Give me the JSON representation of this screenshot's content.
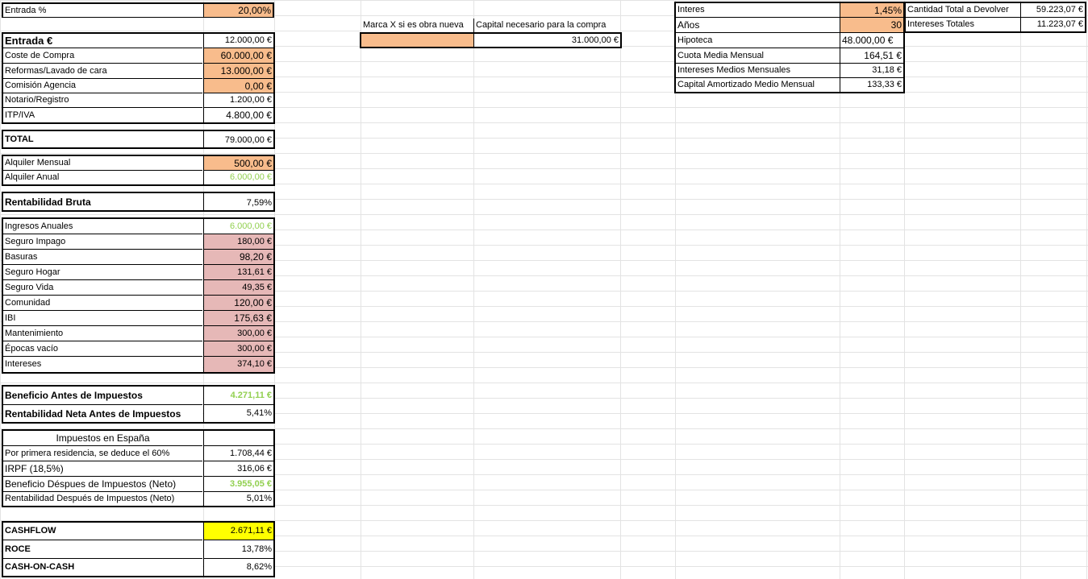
{
  "entrada_pct": {
    "label": "Entrada %",
    "value": "20,00%"
  },
  "main_block": [
    {
      "label": "Entrada €",
      "value": "12.000,00 €"
    },
    {
      "label": "Coste de Compra",
      "value": "60.000,00 €"
    },
    {
      "label": "Reformas/Lavado de cara",
      "value": "13.000,00 €"
    },
    {
      "label": "Comisión Agencia",
      "value": "0,00 €"
    },
    {
      "label": "Notario/Registro",
      "value": "1.200,00 €"
    },
    {
      "label": "ITP/IVA",
      "value": "4.800,00 €"
    }
  ],
  "total": {
    "label": "TOTAL",
    "value": "79.000,00 €"
  },
  "alquiler": [
    {
      "label": "Alquiler Mensual",
      "value": "500,00 €"
    },
    {
      "label": "Alquiler Anual",
      "value": "6.000,00 €"
    }
  ],
  "rent_bruta": {
    "label": "Rentabilidad Bruta",
    "value": "7,59%"
  },
  "ingresos": [
    {
      "label": "Ingresos Anuales",
      "value": "6.000,00 €"
    },
    {
      "label": "Seguro Impago",
      "value": "180,00 €"
    },
    {
      "label": "Basuras",
      "value": "98,20 €"
    },
    {
      "label": "Seguro Hogar",
      "value": "131,61 €"
    },
    {
      "label": "Seguro Vida",
      "value": "49,35 €"
    },
    {
      "label": "Comunidad",
      "value": "120,00 €"
    },
    {
      "label": "IBI",
      "value": "175,63 €"
    },
    {
      "label": "Mantenimiento",
      "value": "300,00 €"
    },
    {
      "label": "Épocas vacío",
      "value": "300,00 €"
    },
    {
      "label": "Intereses",
      "value": "374,10 €"
    }
  ],
  "beneficio": [
    {
      "label": "Beneficio Antes de Impuestos",
      "value": "4.271,11 €"
    },
    {
      "label": "Rentabilidad Neta Antes de Impuestos",
      "value": "5,41%"
    }
  ],
  "impuestos": {
    "header": "Impuestos en España",
    "rows": [
      {
        "label": "Por primera residencia, se deduce el 60%",
        "value": "1.708,44 €"
      },
      {
        "label": "IRPF (18,5%)",
        "value": "316,06 €"
      },
      {
        "label": "Beneficio Déspues de Impuestos (Neto)",
        "value": "3.955,05 €"
      },
      {
        "label": "Rentabilidad Después de Impuestos (Neto)",
        "value": "5,01%"
      }
    ]
  },
  "cashflow": [
    {
      "label": "CASHFLOW",
      "value": "2.671,11 €"
    },
    {
      "label": "ROCE",
      "value": "13,78%"
    },
    {
      "label": "CASH-ON-CASH",
      "value": "8,62%"
    }
  ],
  "mid_block": {
    "h1": "Marca X si es obra nueva",
    "h2": "Capital necesario para la compra",
    "v1": "",
    "v2": "31.000,00 €"
  },
  "hipoteca": [
    {
      "label": "Interes",
      "value": "1,45%"
    },
    {
      "label": "Años",
      "value": "30"
    },
    {
      "label": "Hipoteca",
      "value": "48.000,00 €"
    },
    {
      "label": "Cuota Media Mensual",
      "value": "164,51 €"
    },
    {
      "label": "Intereses Medios Mensuales",
      "value": "31,18 €"
    },
    {
      "label": "Capital Amortizado Medio Mensual",
      "value": "133,33 €"
    }
  ],
  "devolver": [
    {
      "label": "Cantidad Total a Devolver",
      "value": "59.223,07 €"
    },
    {
      "label": "Intereses Totales",
      "value": "11.223,07 €"
    }
  ],
  "colors": {
    "orange": "#f8bc8c",
    "pink": "#e6b8b7",
    "yellow": "#ffff00",
    "green": "#92d050"
  }
}
